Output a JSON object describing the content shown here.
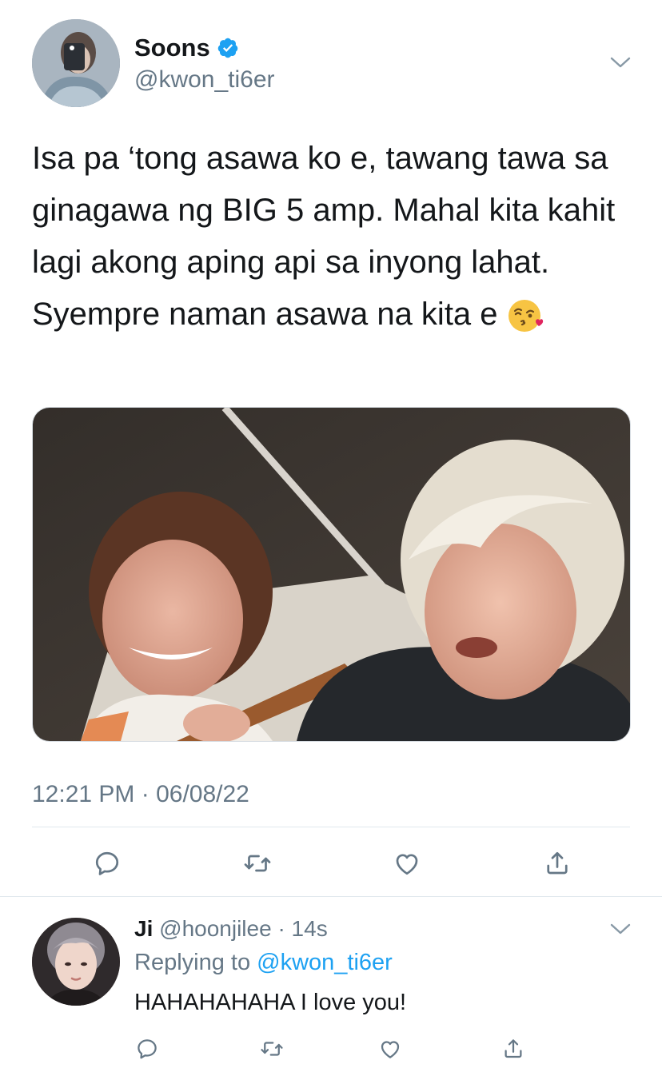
{
  "tweet": {
    "author_name": "Soons",
    "author_handle": "@kwon_ti6er",
    "text": "Isa pa ‘tong asawa ko e, tawang tawa sa ginagawa ng BIG 5 amp. Mahal kita kahit lagi akong aping api sa inyong lahat. Syempre naman asawa na kita e ",
    "emoji": "face-blowing-a-kiss",
    "timestamp": "12:21 PM · 06/08/22",
    "icons": [
      "verified-badge-icon",
      "chevron-down-icon",
      "reply-icon",
      "retweet-icon",
      "like-icon",
      "share-icon"
    ]
  },
  "reply": {
    "author_name": "Ji",
    "author_handle": "@hoonjilee",
    "time": "· 14s",
    "replying_prefix": "Replying to ",
    "replying_to": "@kwon_ti6er",
    "text": "HAHAHAHAHA I love you!"
  },
  "colors": {
    "accent": "#1da1f2",
    "secondary_text": "#657786",
    "divider": "#e1e8ed"
  }
}
